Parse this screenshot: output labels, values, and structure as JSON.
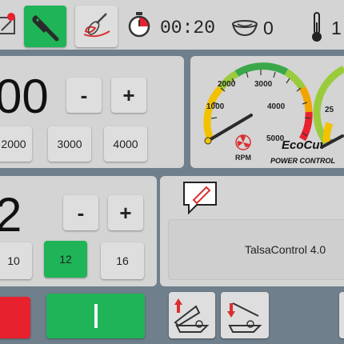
{
  "toolbar": {
    "timer": "00:20",
    "bowl_count": "0"
  },
  "speed": {
    "value": "00",
    "minus_label": "-",
    "plus_label": "+",
    "presets": [
      "2000",
      "3000",
      "4000"
    ]
  },
  "rpm_gauge": {
    "ticks": [
      "1000",
      "2000",
      "3000",
      "4000",
      "5000"
    ],
    "unit": "RPM",
    "brand": "EcoCut",
    "trademark": "™",
    "subtitle": "POWER CONTROL"
  },
  "second_gauge": {
    "ticks": [
      "25"
    ]
  },
  "blades": {
    "value": "2",
    "minus_label": "-",
    "plus_label": "+",
    "options": [
      "10",
      "12",
      "16"
    ],
    "selected": "12"
  },
  "notes": {
    "text": "TalsaControl 4.0"
  },
  "colors": {
    "active": "#1fb457",
    "stop": "#e8212f",
    "panel": "#d4d4d4",
    "background": "#6f7f8c"
  }
}
